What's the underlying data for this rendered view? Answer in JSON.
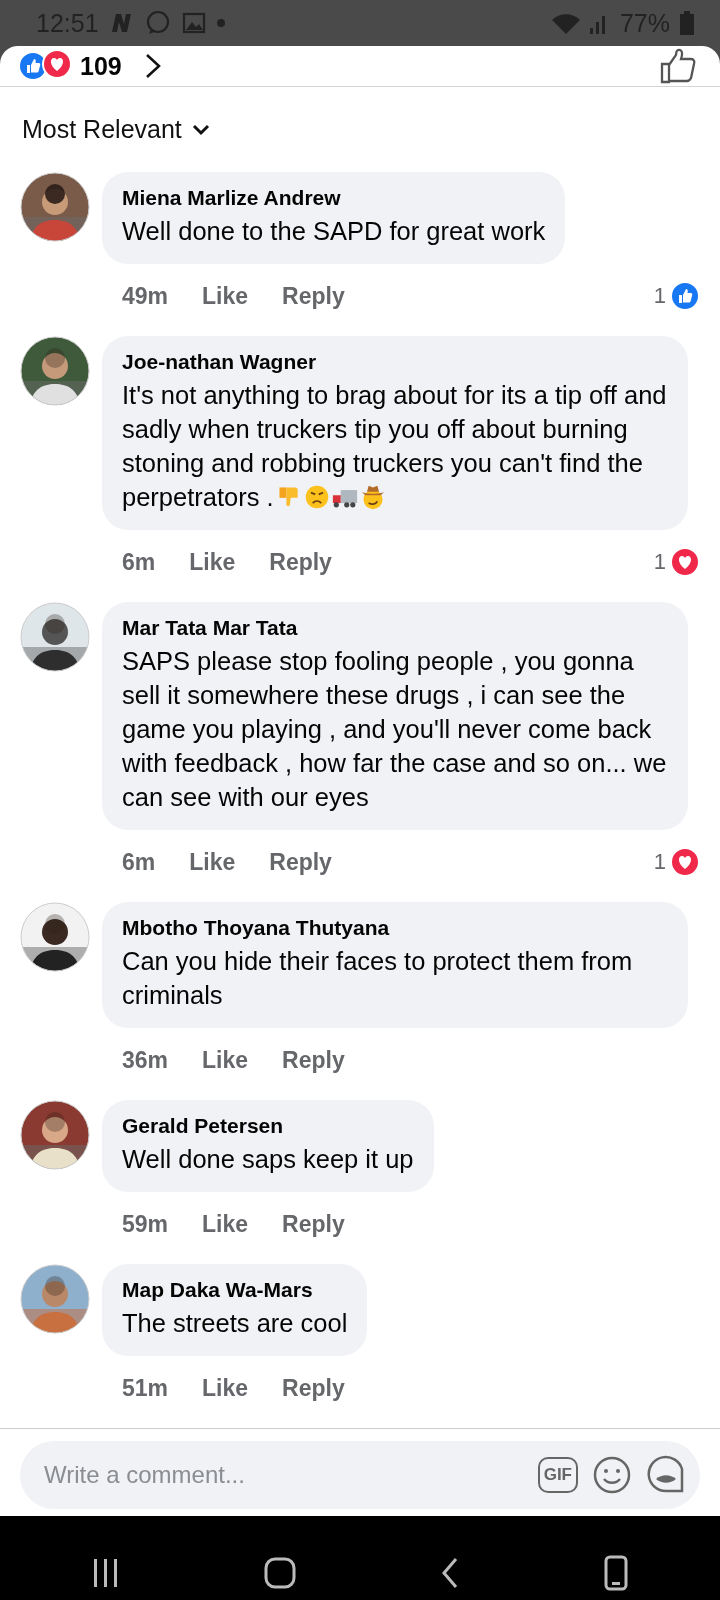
{
  "status_bar": {
    "time": "12:51",
    "battery": "77%"
  },
  "reactions": {
    "count": "109"
  },
  "sort": {
    "label": "Most Relevant"
  },
  "comments": [
    {
      "author": "Miena Marlize Andrew",
      "text": "Well done to the SAPD for great work",
      "time": "49m",
      "like": "Like",
      "reply": "Reply",
      "reaction": {
        "kind": "like",
        "count": "1"
      }
    },
    {
      "author": "Joe-nathan Wagner",
      "text": "It's not anything to brag about for its a tip off and sadly when truckers tip you off about burning stoning and robbing truckers you can't find the perpetrators .",
      "emoji": [
        {
          "kind": "thumbs_down"
        },
        {
          "kind": "frown_face"
        },
        {
          "kind": "truck"
        },
        {
          "kind": "hat_face"
        }
      ],
      "time": "6m",
      "like": "Like",
      "reply": "Reply",
      "reaction": {
        "kind": "love",
        "count": "1"
      }
    },
    {
      "author": "Mar Tata Mar Tata",
      "text": "SAPS please stop fooling people , you gonna sell it somewhere these drugs , i can see the game you playing , and you'll never come back with feedback , how far the case and so on... we can see with our eyes",
      "time": "6m",
      "like": "Like",
      "reply": "Reply",
      "reaction": {
        "kind": "love",
        "count": "1"
      }
    },
    {
      "author": "Mbotho Thoyana Thutyana",
      "text": "Can you hide their faces to protect them from criminals",
      "time": "36m",
      "like": "Like",
      "reply": "Reply"
    },
    {
      "author": "Gerald Petersen",
      "text": "Well done saps keep it up",
      "time": "59m",
      "like": "Like",
      "reply": "Reply"
    },
    {
      "author": "Map Daka Wa-Mars",
      "text": "The streets are cool",
      "time": "51m",
      "like": "Like",
      "reply": "Reply"
    }
  ],
  "composer": {
    "placeholder": "Write a comment...",
    "gif_label": "GIF"
  }
}
